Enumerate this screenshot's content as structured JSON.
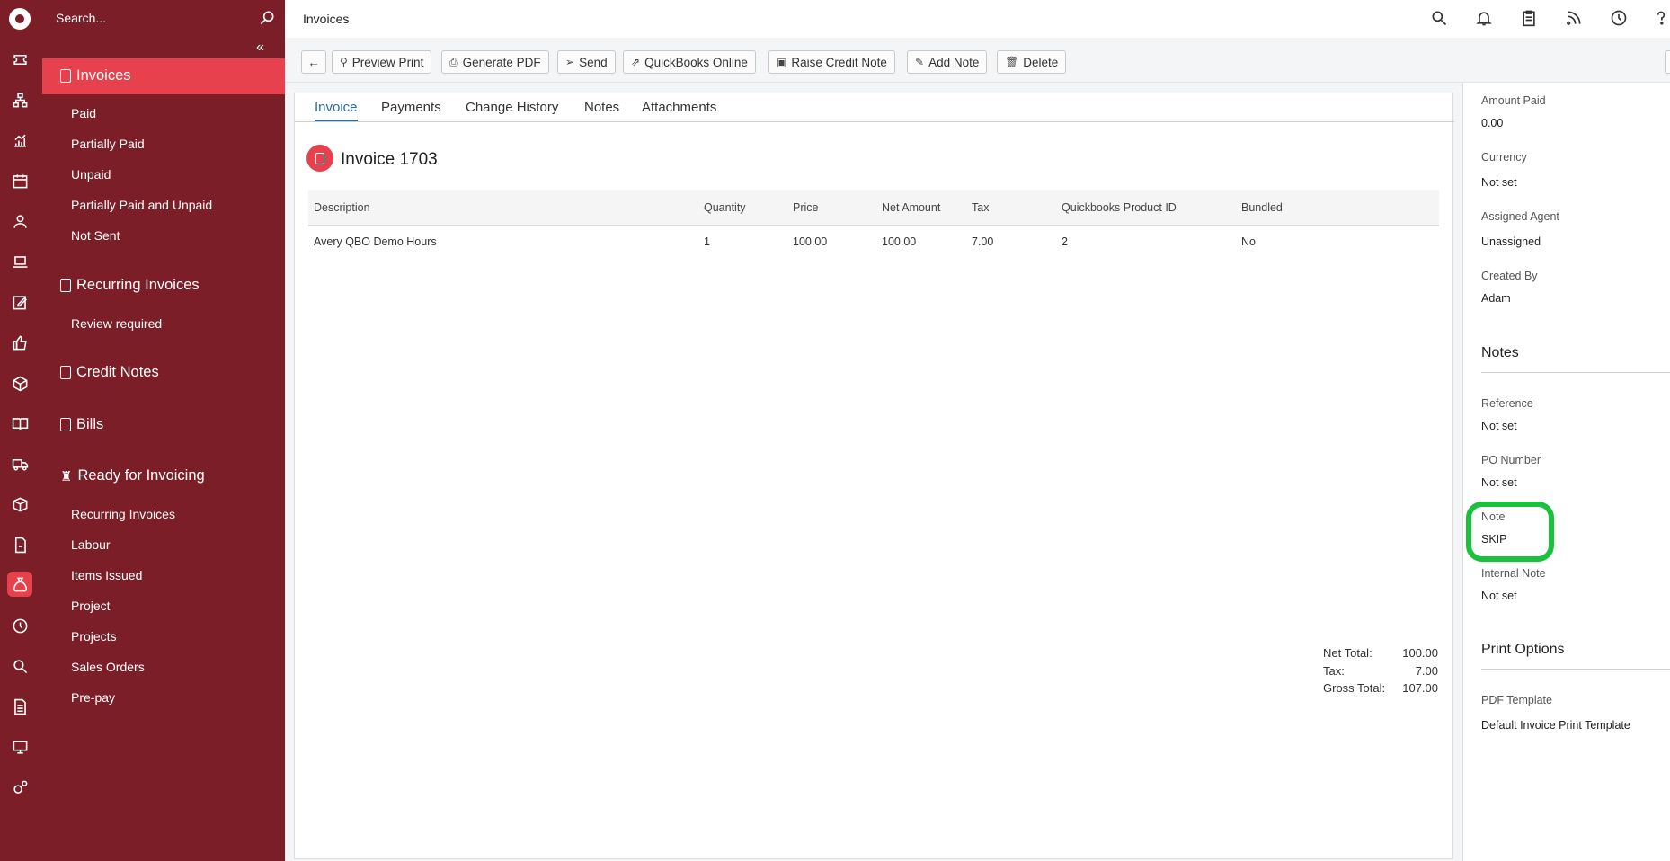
{
  "search": {
    "placeholder": "Search..."
  },
  "page_heading": "Invoices",
  "sidebar": {
    "sections": [
      {
        "label": "Invoices",
        "items": [
          "Paid",
          "Partially Paid",
          "Unpaid",
          "Partially Paid and Unpaid",
          "Not Sent"
        ]
      },
      {
        "label": "Recurring Invoices",
        "items": [
          "Review required"
        ]
      },
      {
        "label": "Credit Notes",
        "items": []
      },
      {
        "label": "Bills",
        "items": []
      },
      {
        "label": "Ready for Invoicing",
        "items": [
          "Recurring Invoices",
          "Labour",
          "Items Issued",
          "Project",
          "Projects",
          "Sales Orders",
          "Pre-pay"
        ]
      }
    ]
  },
  "rail_icons": [
    "logo-icon",
    "ticket-icon",
    "sitemap-icon",
    "chart-icon",
    "calendar-icon",
    "user-icon",
    "laptop-icon",
    "edit-icon",
    "thumbs-up-icon",
    "boxes-icon",
    "book-icon",
    "truck-icon",
    "package-icon",
    "invoice-icon",
    "money-bag-icon",
    "clock-icon",
    "search-icon",
    "document-icon",
    "monitor-icon",
    "gears-icon"
  ],
  "toolbar": {
    "back_label": "←",
    "buttons": [
      "Preview Print",
      "Generate PDF",
      "Send",
      "QuickBooks Online",
      "Raise Credit Note",
      "Add Note",
      "Delete"
    ]
  },
  "tabs": [
    "Invoice",
    "Payments",
    "Change History",
    "Notes",
    "Attachments"
  ],
  "invoice": {
    "title": "Invoice 1703",
    "columns": [
      "Description",
      "Quantity",
      "Price",
      "Net Amount",
      "Tax",
      "Quickbooks Product ID",
      "Bundled"
    ],
    "rows": [
      [
        "Avery QBO Demo Hours",
        "1",
        "100.00",
        "100.00",
        "7.00",
        "2",
        "No"
      ]
    ],
    "totals": [
      {
        "label": "Net Total:",
        "value": "100.00"
      },
      {
        "label": "Tax:",
        "value": "7.00"
      },
      {
        "label": "Gross Total:",
        "value": "107.00"
      }
    ]
  },
  "details": {
    "amount_paid_label": "Amount Paid",
    "amount_paid": "0.00",
    "currency_label": "Currency",
    "currency": "Not set",
    "assigned_agent_label": "Assigned Agent",
    "assigned_agent": "Unassigned",
    "created_by_label": "Created By",
    "created_by": "Adam",
    "notes_heading": "Notes",
    "reference_label": "Reference",
    "reference": "Not set",
    "po_number_label": "PO Number",
    "po_number": "Not set",
    "note_label": "Note",
    "note": "SKIP",
    "internal_note_label": "Internal Note",
    "internal_note": "Not set",
    "print_options_heading": "Print Options",
    "pdf_template_label": "PDF Template",
    "pdf_template": "Default Invoice Print Template"
  },
  "colors": {
    "sidebar": "#7b1e27",
    "active": "#e8414e",
    "tab_active": "#2a6aa8",
    "highlight": "#19c13d"
  }
}
